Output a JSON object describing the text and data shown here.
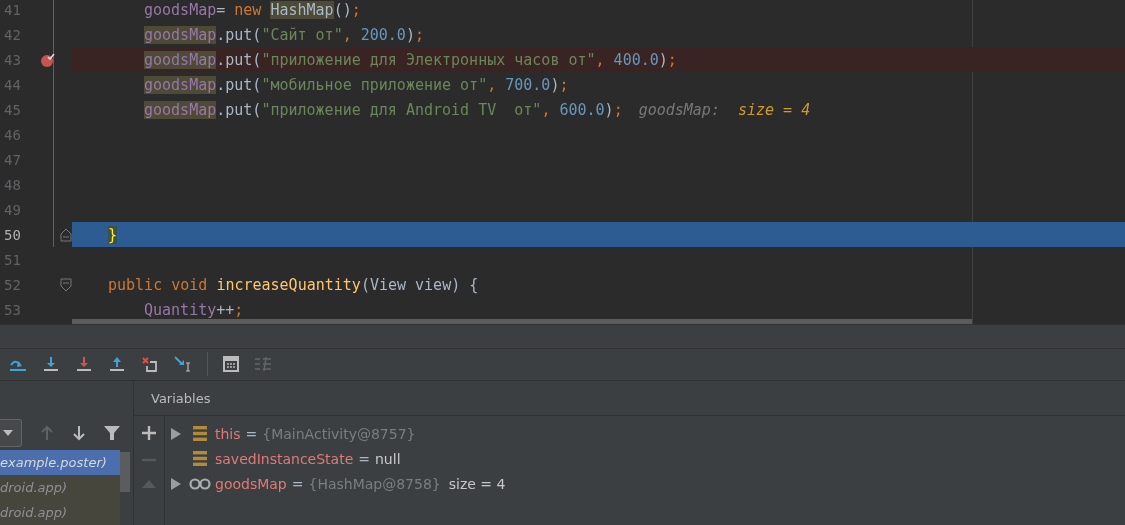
{
  "editor": {
    "lines": [
      {
        "number": "41",
        "kind": "normal",
        "nested": true,
        "tokens": [
          {
            "t": "goodsMap",
            "kind": "field"
          },
          {
            "t": "= ",
            "kind": "plain"
          },
          {
            "t": "new ",
            "kind": "keyword"
          },
          {
            "t": "HashMap",
            "kind": "plain",
            "highlighted": true
          },
          {
            "t": "()",
            "kind": "plain"
          },
          {
            "t": ";",
            "kind": "keyword"
          }
        ]
      },
      {
        "number": "42",
        "kind": "normal",
        "nested": true,
        "tokens": [
          {
            "t": "goodsMap",
            "kind": "field",
            "highlighted": true
          },
          {
            "t": ".put(",
            "kind": "plain"
          },
          {
            "t": "\"Сайт от\"",
            "kind": "string"
          },
          {
            "t": ", ",
            "kind": "keyword"
          },
          {
            "t": "200.0",
            "kind": "number"
          },
          {
            "t": ")",
            "kind": "plain"
          },
          {
            "t": ";",
            "kind": "keyword"
          }
        ]
      },
      {
        "number": "43",
        "kind": "breakpoint",
        "nested": true,
        "tokens": [
          {
            "t": "goodsMap",
            "kind": "field",
            "highlighted": true
          },
          {
            "t": ".put(",
            "kind": "plain"
          },
          {
            "t": "\"приложение для Электронных часов от\"",
            "kind": "string"
          },
          {
            "t": ", ",
            "kind": "keyword"
          },
          {
            "t": "400.0",
            "kind": "number"
          },
          {
            "t": ")",
            "kind": "plain"
          },
          {
            "t": ";",
            "kind": "keyword"
          }
        ]
      },
      {
        "number": "44",
        "kind": "normal",
        "nested": true,
        "tokens": [
          {
            "t": "goodsMap",
            "kind": "field",
            "highlighted": true
          },
          {
            "t": ".put(",
            "kind": "plain"
          },
          {
            "t": "\"мобильное приложение от\"",
            "kind": "string"
          },
          {
            "t": ", ",
            "kind": "keyword"
          },
          {
            "t": "700.0",
            "kind": "number"
          },
          {
            "t": ")",
            "kind": "plain"
          },
          {
            "t": ";",
            "kind": "keyword"
          }
        ]
      },
      {
        "number": "45",
        "kind": "normal",
        "nested": true,
        "tokens": [
          {
            "t": "goodsMap",
            "kind": "field",
            "highlighted": true
          },
          {
            "t": ".put(",
            "kind": "plain"
          },
          {
            "t": "\"приложение для Android TV  от\"",
            "kind": "string"
          },
          {
            "t": ", ",
            "kind": "keyword"
          },
          {
            "t": "600.0",
            "kind": "number"
          },
          {
            "t": ")",
            "kind": "plain"
          },
          {
            "t": ";",
            "kind": "keyword"
          },
          {
            "t": "goodsMap:",
            "kind": "hint-name"
          },
          {
            "t": "size = 4",
            "kind": "hint-value"
          }
        ]
      },
      {
        "number": "46",
        "kind": "normal"
      },
      {
        "number": "47",
        "kind": "normal"
      },
      {
        "number": "48",
        "kind": "normal"
      },
      {
        "number": "49",
        "kind": "normal"
      },
      {
        "number": "50",
        "kind": "current",
        "fold_end": true,
        "nested": false,
        "tokens": [
          {
            "t": "}",
            "kind": "brace",
            "highlighted": true
          }
        ]
      },
      {
        "number": "51",
        "kind": "normal"
      },
      {
        "number": "52",
        "kind": "normal",
        "fold_start": true,
        "nested": false,
        "tokens": [
          {
            "t": "public void ",
            "kind": "keyword"
          },
          {
            "t": "increaseQuantity",
            "kind": "method"
          },
          {
            "t": "(View view) {",
            "kind": "plain"
          }
        ]
      },
      {
        "number": "53",
        "kind": "normal",
        "nested": true,
        "tokens": [
          {
            "t": "Quantity",
            "kind": "field"
          },
          {
            "t": "++",
            "kind": "plain"
          },
          {
            "t": ";",
            "kind": "keyword"
          }
        ]
      }
    ]
  },
  "debug_toolbar": [
    {
      "kind": "step-over",
      "disabled": false
    },
    {
      "kind": "step-into",
      "disabled": false
    },
    {
      "kind": "force-step-into",
      "disabled": false
    },
    {
      "kind": "step-out",
      "disabled": false
    },
    {
      "kind": "drop-frame",
      "disabled": false
    },
    {
      "kind": "run-to-cursor",
      "disabled": false
    },
    {
      "kind": "separator"
    },
    {
      "kind": "evaluate",
      "disabled": false
    },
    {
      "kind": "trace",
      "disabled": true
    }
  ],
  "frames": {
    "buttons": [
      {
        "kind": "up",
        "disabled": true
      },
      {
        "kind": "down",
        "disabled": false
      },
      {
        "kind": "filter",
        "disabled": false
      }
    ],
    "items": [
      {
        "label": "example.poster)",
        "selected": true
      },
      {
        "label": "droid.app)",
        "selected": false
      },
      {
        "label": "droid.app)",
        "selected": false
      }
    ]
  },
  "variables": {
    "title": "Variables",
    "side_buttons": [
      {
        "kind": "add",
        "disabled": false
      },
      {
        "kind": "remove",
        "disabled": true
      },
      {
        "kind": "up",
        "disabled": true
      }
    ],
    "rows": [
      {
        "expandable": true,
        "kind": "field",
        "name": "this",
        "operator": "=",
        "value": "{MainActivity@8757}",
        "reference": true
      },
      {
        "expandable": false,
        "kind": "field",
        "name": "savedInstanceState",
        "operator": "=",
        "value": "null",
        "reference": false
      },
      {
        "expandable": true,
        "kind": "watch",
        "name": "goodsMap",
        "operator": "=",
        "value": "{HashMap@8758}",
        "reference": true,
        "extra": "size = 4"
      }
    ]
  }
}
